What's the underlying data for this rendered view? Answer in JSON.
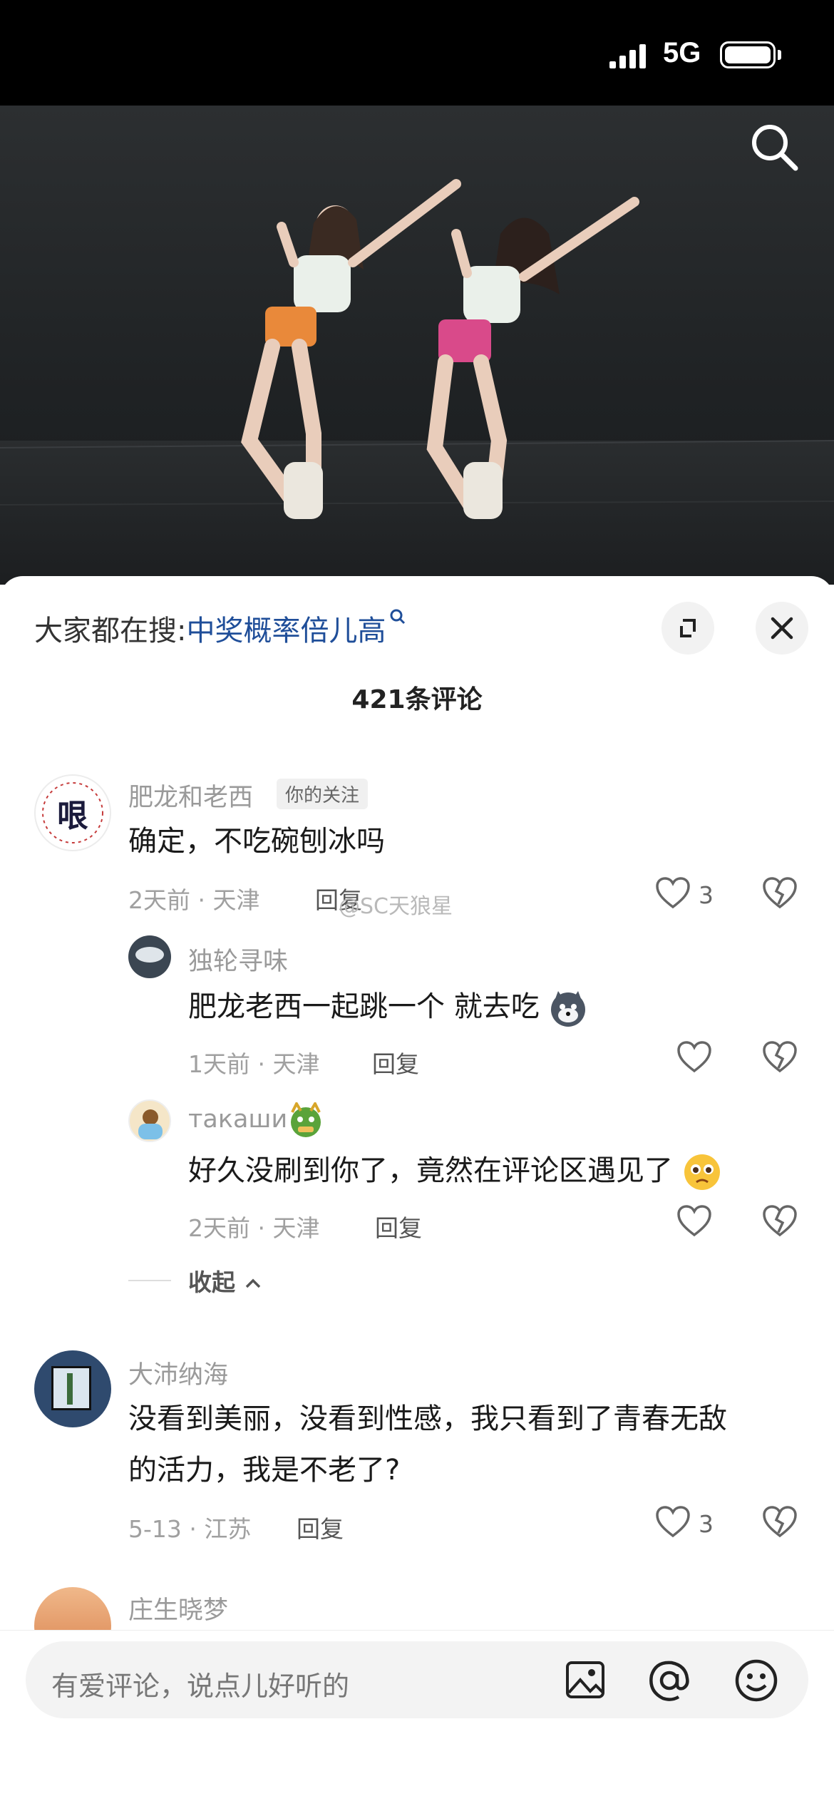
{
  "status": {
    "network": "5G"
  },
  "hot_search": {
    "prefix": "大家都在搜:",
    "keyword": "中奖概率倍儿高"
  },
  "comments_count": "421条评论",
  "comments": [
    {
      "name": "肥龙和老西",
      "tag": "你的关注",
      "avatar_text": "哏",
      "text": "确定，不吃碗刨冰吗",
      "meta": "2天前 · 天津",
      "reply": "回复",
      "likes": "3",
      "replies": [
        {
          "name": "独轮寻味",
          "text": "肥龙老西一起跳一个 就去吃",
          "meta": "1天前 · 天津",
          "reply": "回复"
        },
        {
          "name": "такаши",
          "text": "好久没刷到你了，竟然在评论区遇见了",
          "meta": "2天前 · 天津",
          "reply": "回复"
        }
      ],
      "collapse": "收起"
    },
    {
      "name": "大沛纳海",
      "text_line1": "没看到美丽，没看到性感，我只看到了青春无敌",
      "text_line2": "的活力，我是不老了?",
      "meta": "5-13 · 江苏",
      "reply": "回复",
      "likes": "3"
    },
    {
      "name": "庄生晓梦"
    }
  ],
  "watermark": "@SC天狼星",
  "input": {
    "placeholder": "有爱评论，说点儿好听的"
  },
  "colors": {
    "keyword": "#1f4e99",
    "meta": "#a0a0a0",
    "accent_orange": "#e9893a",
    "accent_pink": "#d94a8a"
  }
}
